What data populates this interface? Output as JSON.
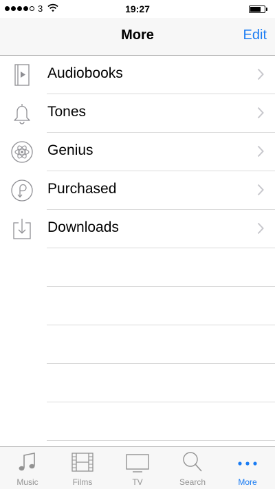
{
  "status_bar": {
    "carrier": "3",
    "time": "19:27"
  },
  "nav": {
    "title": "More",
    "edit_label": "Edit"
  },
  "list": {
    "items": [
      {
        "label": "Audiobooks",
        "icon": "audiobook-icon"
      },
      {
        "label": "Tones",
        "icon": "bell-icon"
      },
      {
        "label": "Genius",
        "icon": "atom-icon"
      },
      {
        "label": "Purchased",
        "icon": "purchased-icon"
      },
      {
        "label": "Downloads",
        "icon": "download-icon"
      }
    ]
  },
  "tab_bar": {
    "tabs": [
      {
        "label": "Music",
        "icon": "music-note-icon"
      },
      {
        "label": "Films",
        "icon": "film-strip-icon"
      },
      {
        "label": "TV",
        "icon": "tv-icon"
      },
      {
        "label": "Search",
        "icon": "search-icon"
      },
      {
        "label": "More",
        "icon": "more-dots-icon",
        "active": true
      }
    ]
  },
  "colors": {
    "accent": "#1a7cf3",
    "inactive": "#929292",
    "icon_gray": "#8e8e93"
  }
}
